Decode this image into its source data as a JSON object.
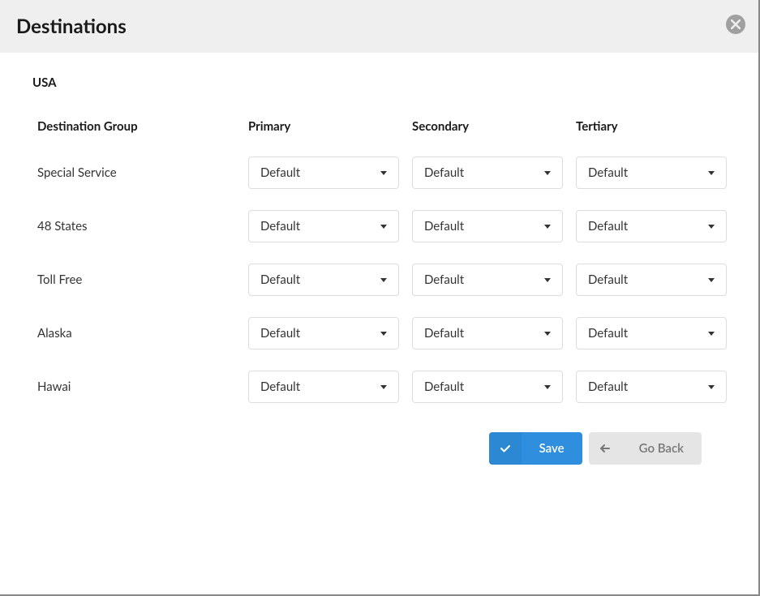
{
  "header": {
    "title": "Destinations"
  },
  "region": "USA",
  "columns": {
    "group": "Destination Group",
    "primary": "Primary",
    "secondary": "Secondary",
    "tertiary": "Tertiary"
  },
  "rows": [
    {
      "label": "Special Service",
      "primary": "Default",
      "secondary": "Default",
      "tertiary": "Default"
    },
    {
      "label": "48 States",
      "primary": "Default",
      "secondary": "Default",
      "tertiary": "Default"
    },
    {
      "label": "Toll Free",
      "primary": "Default",
      "secondary": "Default",
      "tertiary": "Default"
    },
    {
      "label": "Alaska",
      "primary": "Default",
      "secondary": "Default",
      "tertiary": "Default"
    },
    {
      "label": "Hawai",
      "primary": "Default",
      "secondary": "Default",
      "tertiary": "Default"
    }
  ],
  "buttons": {
    "save": "Save",
    "back": "Go Back"
  }
}
